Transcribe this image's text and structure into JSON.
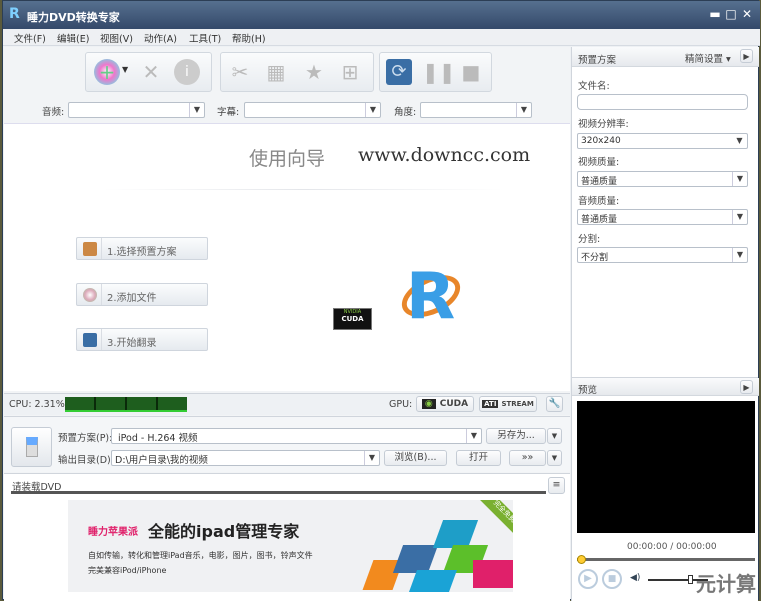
{
  "window": {
    "title": "睡力DVD转换专家",
    "minimize": "▬",
    "maximize": "□",
    "close": "✕"
  },
  "menu": [
    "文件(F)",
    "编辑(E)",
    "视图(V)",
    "动作(A)",
    "工具(T)",
    "帮助(H)"
  ],
  "toolbar": {
    "icons": [
      "add-disc-icon",
      "delete-icon",
      "info-icon",
      "cut-icon",
      "film-icon",
      "effects-icon",
      "merge-icon",
      "convert-icon",
      "pause-icon",
      "stop-icon"
    ]
  },
  "selectors": {
    "audio_label": "音频:",
    "subtitle_label": "字幕:",
    "angle_label": "角度:",
    "audio": "",
    "subtitle": "",
    "angle": ""
  },
  "wizard": {
    "title": "使用向导",
    "watermark": "www.downcc.com",
    "steps": [
      "1.选择预置方案",
      "2.添加文件",
      "3.开始翻录"
    ],
    "cuda_badge_top": "NVIDIA",
    "cuda_badge": "CUDA"
  },
  "status": {
    "cpu": "CPU: 2.31%",
    "gpu_label": "GPU:",
    "cuda": "CUDA",
    "stream": "STREAM",
    "ati": "ATI"
  },
  "output": {
    "preset_label": "预置方案(P):",
    "preset_value": "iPod - H.264 视频",
    "save_as": "另存为...",
    "dir_label": "输出目录(D):",
    "dir_value": "D:\\用户目录\\我的视频",
    "browse": "浏览(B)...",
    "open": "打开",
    "transfer": "»»"
  },
  "task": {
    "message": "请装载DVD"
  },
  "ad": {
    "brand": "睡力苹果派",
    "headline": "全能的ipad管理专家",
    "line1": "自如传输，转化和管理iPad音乐，电影，图片，图书，铃声文件",
    "line2": "完美兼容iPod/iPhone",
    "ribbon": "完全免费"
  },
  "right": {
    "header": "预置方案",
    "mode": "精简设置 ▾",
    "filename_label": "文件名:",
    "filename": "",
    "resolution_label": "视频分辨率:",
    "resolution": "320x240",
    "vquality_label": "视频质量:",
    "vquality": "普通质量",
    "aquality_label": "音频质量:",
    "aquality": "普通质量",
    "split_label": "分割:",
    "split": "不分割"
  },
  "preview": {
    "header": "预览",
    "time": "00:00:00 / 00:00:00",
    "progress": 0,
    "volume": 0.7
  },
  "overlay": "元计算",
  "colors": {
    "title_bar": "#34496a",
    "accent_blue": "#3a6ea5",
    "cpu_graph": "#1e5e1e"
  }
}
